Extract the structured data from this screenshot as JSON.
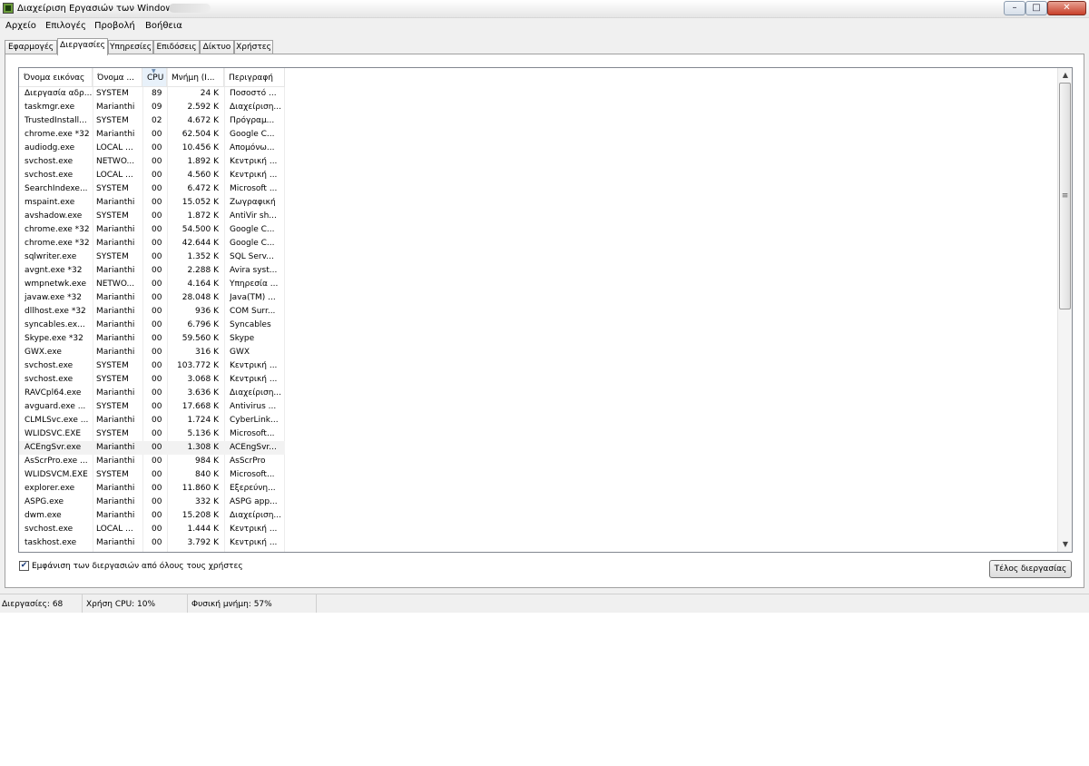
{
  "window": {
    "title": "Διαχείριση Εργασιών των Windows"
  },
  "title_buttons": {
    "minimize": "–",
    "maximize": "□",
    "close": "✕"
  },
  "menu": [
    "Αρχείο",
    "Επιλογές",
    "Προβολή",
    "Βοήθεια"
  ],
  "tabs": [
    "Εφαρμογές",
    "Διεργασίες",
    "Υπηρεσίες",
    "Επιδόσεις",
    "Δίκτυο",
    "Χρήστες"
  ],
  "active_tab": "Διεργασίες",
  "columns": [
    "Όνομα εικόνας",
    "Όνομα ...",
    "CPU",
    "Μνήμη (Ι...",
    "Περιγραφή"
  ],
  "sorted_column": "CPU",
  "rows": [
    [
      "Διεργασία αδρ...",
      "SYSTEM",
      "89",
      "24 K",
      "Ποσοστό ..."
    ],
    [
      "taskmgr.exe",
      "Marianthi",
      "09",
      "2.592 K",
      "Διαχείριση..."
    ],
    [
      "TrustedInstall...",
      "SYSTEM",
      "02",
      "4.672 K",
      "Πρόγραμ..."
    ],
    [
      "chrome.exe *32",
      "Marianthi",
      "00",
      "62.504 K",
      "Google C..."
    ],
    [
      "audiodg.exe",
      "LOCAL ...",
      "00",
      "10.456 K",
      "Απομόνω..."
    ],
    [
      "svchost.exe",
      "NETWO...",
      "00",
      "1.892 K",
      "Κεντρική ..."
    ],
    [
      "svchost.exe",
      "LOCAL ...",
      "00",
      "4.560 K",
      "Κεντρική ..."
    ],
    [
      "SearchIndexe...",
      "SYSTEM",
      "00",
      "6.472 K",
      "Microsoft ..."
    ],
    [
      "mspaint.exe",
      "Marianthi",
      "00",
      "15.052 K",
      "Ζωγραφική"
    ],
    [
      "avshadow.exe",
      "SYSTEM",
      "00",
      "1.872 K",
      "AntiVir sh..."
    ],
    [
      "chrome.exe *32",
      "Marianthi",
      "00",
      "54.500 K",
      "Google C..."
    ],
    [
      "chrome.exe *32",
      "Marianthi",
      "00",
      "42.644 K",
      "Google C..."
    ],
    [
      "sqlwriter.exe",
      "SYSTEM",
      "00",
      "1.352 K",
      "SQL Serv..."
    ],
    [
      "avgnt.exe *32",
      "Marianthi",
      "00",
      "2.288 K",
      "Avira syst..."
    ],
    [
      "wmpnetwk.exe",
      "NETWO...",
      "00",
      "4.164 K",
      "Υπηρεσία ..."
    ],
    [
      "javaw.exe *32",
      "Marianthi",
      "00",
      "28.048 K",
      "Java(TM) ..."
    ],
    [
      "dllhost.exe *32",
      "Marianthi",
      "00",
      "936 K",
      "COM Surr..."
    ],
    [
      "syncables.ex...",
      "Marianthi",
      "00",
      "6.796 K",
      "Syncables"
    ],
    [
      "Skype.exe *32",
      "Marianthi",
      "00",
      "59.560 K",
      "Skype"
    ],
    [
      "GWX.exe",
      "Marianthi",
      "00",
      "316 K",
      "GWX"
    ],
    [
      "svchost.exe",
      "SYSTEM",
      "00",
      "103.772 K",
      "Κεντρική ..."
    ],
    [
      "svchost.exe",
      "SYSTEM",
      "00",
      "3.068 K",
      "Κεντρική ..."
    ],
    [
      "RAVCpl64.exe",
      "Marianthi",
      "00",
      "3.636 K",
      "Διαχείριση..."
    ],
    [
      "avguard.exe ...",
      "SYSTEM",
      "00",
      "17.668 K",
      "Antivirus ..."
    ],
    [
      "CLMLSvc.exe ...",
      "Marianthi",
      "00",
      "1.724 K",
      "CyberLink..."
    ],
    [
      "WLIDSVC.EXE",
      "SYSTEM",
      "00",
      "5.136 K",
      "Microsoft..."
    ],
    [
      "ACEngSvr.exe",
      "Marianthi",
      "00",
      "1.308 K",
      "ACEngSvr..."
    ],
    [
      "AsScrPro.exe ...",
      "Marianthi",
      "00",
      "984 K",
      "AsScrPro"
    ],
    [
      "WLIDSVCM.EXE",
      "SYSTEM",
      "00",
      "840 K",
      "Microsoft..."
    ],
    [
      "explorer.exe",
      "Marianthi",
      "00",
      "11.860 K",
      "Εξερεύνη..."
    ],
    [
      "ASPG.exe",
      "Marianthi",
      "00",
      "332 K",
      "ASPG app..."
    ],
    [
      "dwm.exe",
      "Marianthi",
      "00",
      "15.208 K",
      "Διαχείριση..."
    ],
    [
      "svchost.exe",
      "LOCAL ...",
      "00",
      "1.444 K",
      "Κεντρική ..."
    ],
    [
      "taskhost.exe",
      "Marianthi",
      "00",
      "3.792 K",
      "Κεντρική ..."
    ]
  ],
  "highlighted_row": 26,
  "show_all_users": {
    "checked": true,
    "label": "Εμφάνιση των διεργασιών από όλους τους χρήστες"
  },
  "end_process_button": "Τέλος διεργασίας",
  "status": {
    "processes": "Διεργασίες: 68",
    "cpu_usage": "Χρήση CPU: 10%",
    "physical_memory": "Φυσική μνήμη: 57%"
  }
}
